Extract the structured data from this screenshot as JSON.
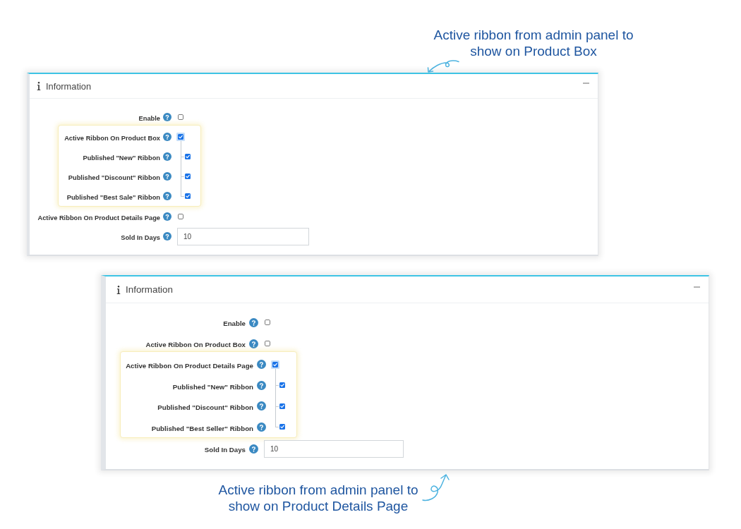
{
  "top_note": {
    "text": "Active ribbon from admin panel to show on Product Box"
  },
  "panels": [
    {
      "title": "Information",
      "fields": [
        {
          "kind": "checkbox",
          "label": "Enable",
          "checked": false,
          "focused": false,
          "highlighted": false
        },
        {
          "kind": "checkbox",
          "label": "Active Ribbon On Product Box",
          "checked": true,
          "focused": true,
          "highlighted": true,
          "children": [
            {
              "label": "Published \"New\" Ribbon",
              "checked": true
            },
            {
              "label": "Published \"Discount\" Ribbon",
              "checked": true
            },
            {
              "label": "Published \"Best Sale\" Ribbon",
              "checked": true
            }
          ]
        },
        {
          "kind": "checkbox",
          "label": "Active Ribbon On Product Details Page",
          "checked": false,
          "focused": false,
          "highlighted": false
        },
        {
          "kind": "text",
          "label": "Sold In Days",
          "value": "10",
          "focused": false,
          "highlighted": false
        }
      ]
    },
    {
      "title": "Information",
      "fields": [
        {
          "kind": "checkbox",
          "label": "Enable",
          "checked": false,
          "focused": false,
          "highlighted": false
        },
        {
          "kind": "checkbox",
          "label": "Active Ribbon On Product Box",
          "checked": false,
          "focused": false,
          "highlighted": false
        },
        {
          "kind": "checkbox",
          "label": "Active Ribbon On Product Details Page",
          "checked": true,
          "focused": true,
          "highlighted": true,
          "children": [
            {
              "label": "Published \"New\" Ribbon",
              "checked": true
            },
            {
              "label": "Published \"Discount\" Ribbon",
              "checked": true
            },
            {
              "label": "Published \"Best Seller\" Ribbon",
              "checked": true
            }
          ]
        },
        {
          "kind": "text",
          "label": "Sold In Days",
          "value": "10",
          "focused": false,
          "highlighted": false
        }
      ]
    }
  ],
  "bottom_note": {
    "text": "Active ribbon from admin panel to show on Product Details Page"
  }
}
